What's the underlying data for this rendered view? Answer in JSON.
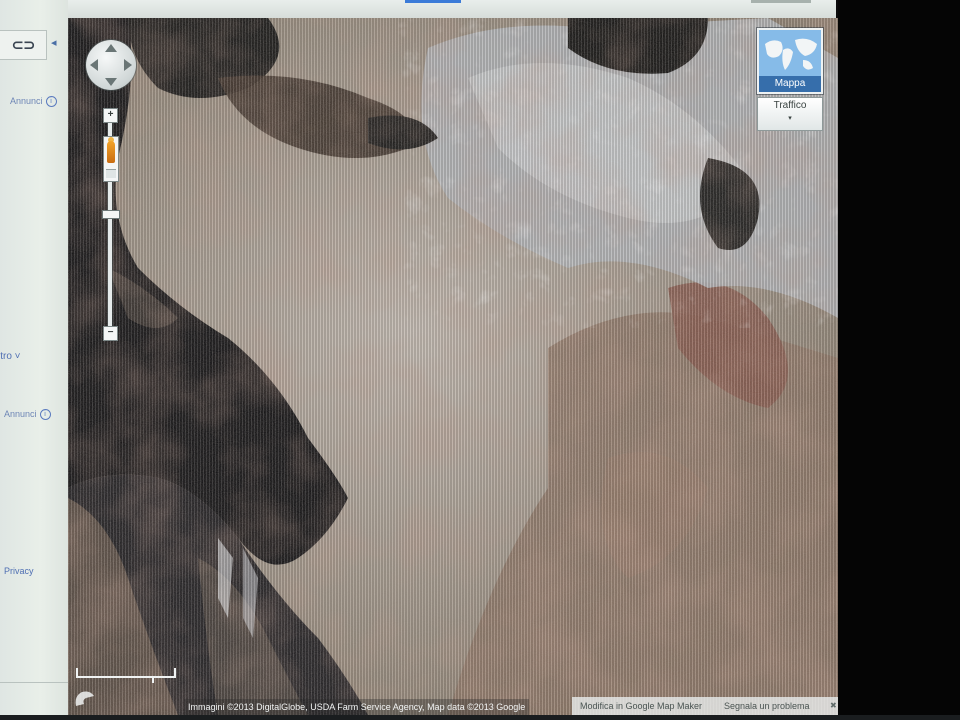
{
  "sidebar": {
    "link_glyph": "⊂⊃",
    "collapse_glyph": "◂",
    "ad_top_label": "Annunci",
    "ad_bottom_label": "Annunci",
    "info_glyph": "i",
    "filter_link": "ltro ˅",
    "privacy_link": "Privacy"
  },
  "map": {
    "type_button_label": "Mappa",
    "traffic_button_label": "Traffico",
    "traffic_caret": "▾",
    "zoom_in_glyph": "+",
    "zoom_out_glyph": "−",
    "attribution": "Immagini ©2013 DigitalGlobe, USDA Farm Service Agency, Map data ©2013 Google",
    "footer_mapmaker_link": "Modifica in Google Map Maker",
    "footer_report_link": "Segnala un problema",
    "footer_close_glyph": "✖",
    "zoom_level_fraction": 0.45,
    "icons": {
      "pan": "compass-pan-icon",
      "pegman": "pegman-icon",
      "map_type_thumb": "world-map-icon",
      "link": "link-chain-icon",
      "info": "info-icon",
      "logo": "google-logo-icon"
    },
    "colors": {
      "map_type_button": "#7fb6e6",
      "map_type_label_bg": "#2860a0",
      "pegman": "#e08a1e",
      "link_text": "#4f6fb3"
    }
  }
}
